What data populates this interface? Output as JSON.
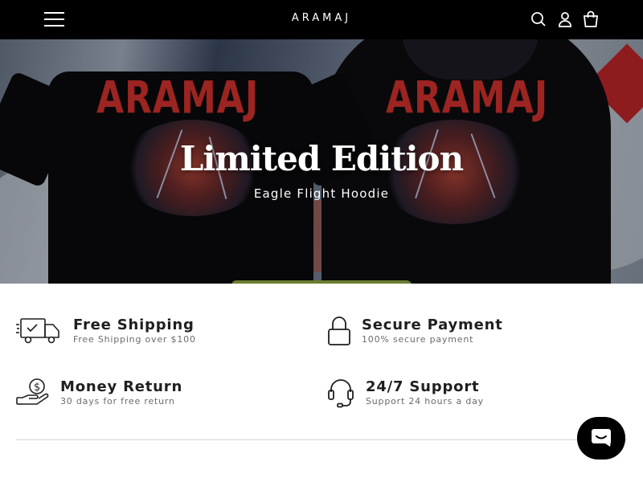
{
  "header": {
    "brand": "ARAMAJ",
    "icons": [
      "menu-icon",
      "search-icon",
      "account-icon",
      "cart-icon"
    ]
  },
  "hero": {
    "title": "Limited Edition",
    "subtitle": "Eagle Flight Hoodie",
    "product_print_text": "ARAMAJ"
  },
  "features": [
    {
      "title": "Free Shipping",
      "description": "Free Shipping over $100",
      "icon": "delivery-truck-icon"
    },
    {
      "title": "Secure Payment",
      "description": "100% secure payment",
      "icon": "lock-icon"
    },
    {
      "title": "Money Return",
      "description": "30 days for free return",
      "icon": "money-hand-icon"
    },
    {
      "title": "24/7 Support",
      "description": "Support 24 hours a day",
      "icon": "headset-icon"
    }
  ],
  "chat": {
    "icon": "chat-icon"
  },
  "colors": {
    "header_bg": "#000000",
    "accent_red": "#d8322f",
    "text": "#1f1f1f",
    "muted": "#6b6b6b"
  }
}
